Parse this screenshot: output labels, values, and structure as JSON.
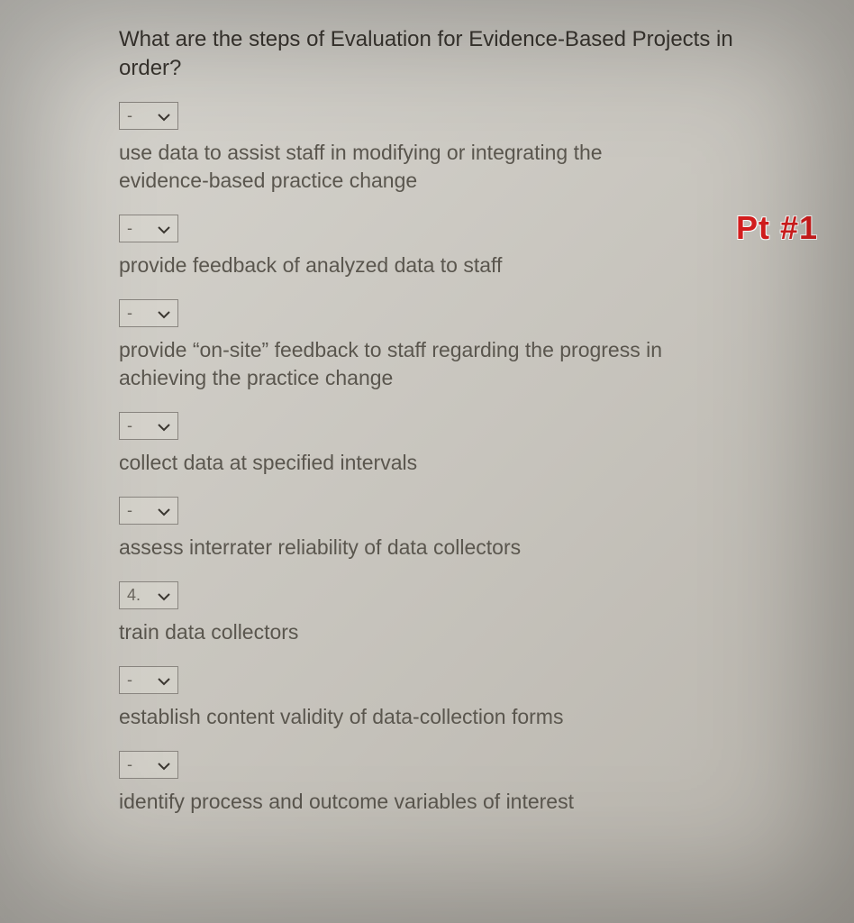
{
  "question": "What are the steps of Evaluation for Evidence-Based Projects in order?",
  "annotation": "Pt #1",
  "items": [
    {
      "selected": "-",
      "text": "use data to assist staff in modifying or integrating the evidence-based practice change"
    },
    {
      "selected": "-",
      "text": "provide feedback of analyzed data to staff"
    },
    {
      "selected": "-",
      "text": "provide “on-site” feedback to staff regarding the progress in achieving the practice change"
    },
    {
      "selected": "-",
      "text": "collect data at specified intervals"
    },
    {
      "selected": "-",
      "text": "assess interrater reliability of data collectors"
    },
    {
      "selected": "4.",
      "text": "train data collectors"
    },
    {
      "selected": "-",
      "text": "establish content validity of data-collection forms"
    },
    {
      "selected": "-",
      "text": "identify process and outcome variables of interest"
    }
  ]
}
